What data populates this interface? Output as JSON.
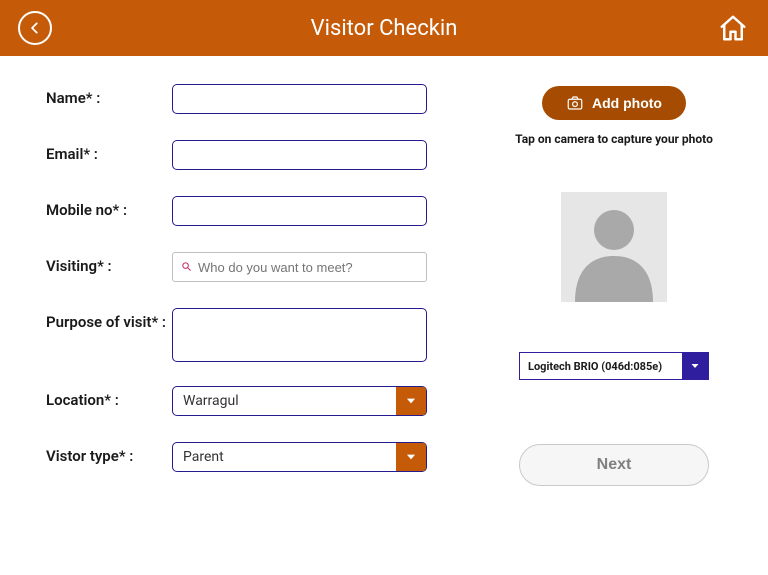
{
  "header": {
    "title": "Visitor Checkin"
  },
  "form": {
    "name_label": "Name* :",
    "name_value": "",
    "email_label": "Email* :",
    "email_value": "",
    "mobile_label": "Mobile no* :",
    "mobile_value": "",
    "visiting_label": "Visiting* :",
    "visiting_placeholder": "Who do you want to meet?",
    "visiting_value": "",
    "purpose_label": "Purpose of visit* :",
    "purpose_value": "",
    "location_label": "Location* :",
    "location_value": "Warragul",
    "visitor_type_label": "Vistor type* :",
    "visitor_type_value": "Parent"
  },
  "photo": {
    "add_button": "Add photo",
    "hint": "Tap on camera to capture your photo",
    "camera_device": "Logitech BRIO (046d:085e)"
  },
  "actions": {
    "next": "Next"
  }
}
